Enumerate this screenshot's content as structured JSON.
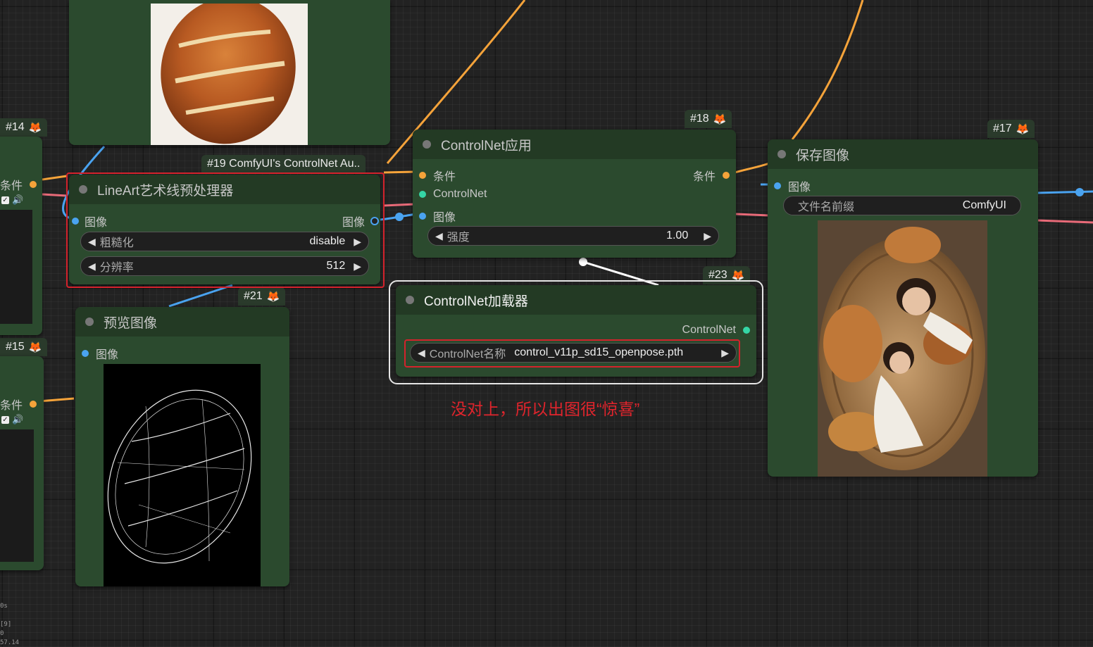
{
  "nodes": {
    "n14": {
      "id_label": "#14",
      "output_label": "条件"
    },
    "n15": {
      "id_label": "#15",
      "output_label": "条件"
    },
    "n19": {
      "id_label": "#19 ComfyUI's ControlNet Au..",
      "title": "LineArt艺术线预处理器",
      "input_label": "图像",
      "output_label": "图像",
      "widgets": [
        {
          "name": "粗糙化",
          "value": "disable"
        },
        {
          "name": "分辨率",
          "value": "512"
        }
      ]
    },
    "n21": {
      "id_label": "#21",
      "title": "预览图像",
      "input_label": "图像"
    },
    "n18": {
      "id_label": "#18",
      "title": "ControlNet应用",
      "inputs": [
        "条件",
        "ControlNet",
        "图像"
      ],
      "output_label": "条件",
      "widgets": [
        {
          "name": "强度",
          "value": "1.00"
        }
      ]
    },
    "n23": {
      "id_label": "#23",
      "title": "ControlNet加载器",
      "output_label": "ControlNet",
      "widgets": [
        {
          "name": "ControlNet名称",
          "value": "control_v11p_sd15_openpose.pth"
        }
      ]
    },
    "n17": {
      "id_label": "#17",
      "title": "保存图像",
      "input_label": "图像",
      "widgets": [
        {
          "name": "文件名前缀",
          "value": "ComfyUI"
        }
      ]
    }
  },
  "annotation": "没对上，所以出图很“惊喜”",
  "stats": [
    "0s",
    "[9]",
    "0",
    "57.14"
  ],
  "colors": {
    "canvas": "#222222",
    "node_body": "#2b4a2e",
    "node_header": "#233a24",
    "wire_conditioning": "#f5a33a",
    "wire_image": "#4aa3f0",
    "wire_latent": "#e86a78",
    "wire_controlnet": "#ffffff",
    "highlight_red": "#d4232c"
  }
}
